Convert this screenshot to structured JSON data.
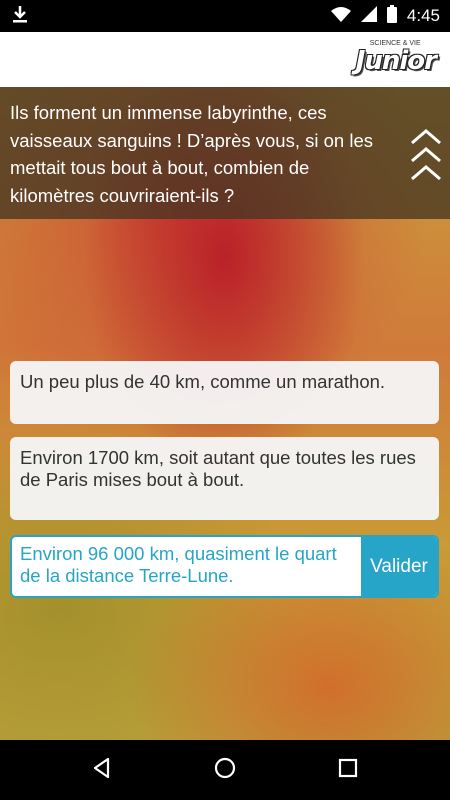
{
  "status_bar": {
    "time": "4:45",
    "icons": [
      "download-icon",
      "wifi-icon",
      "cellular-signal-icon",
      "battery-icon"
    ]
  },
  "header": {
    "logo_text": "Junior",
    "logo_small_text": "SCIENCE & VIE"
  },
  "question": {
    "text": "Ils forment un immense labyrinthe, ces vaisseaux sanguins ! D’après vous, si on les mettait tous bout à bout, combien de kilomètres couvriraient-ils ?"
  },
  "answers": [
    {
      "label": "Un peu plus de 40 km, comme un marathon."
    },
    {
      "label": "Environ 1700 km, soit autant que toutes les rues de Paris mises bout à bout."
    },
    {
      "label": "Environ 96 000 km, quasiment le quart de la distance Terre-Lune.",
      "selected": true
    }
  ],
  "validate_label": "Valider",
  "colors": {
    "accent": "#26a5c8",
    "panel": "#46372380"
  },
  "nav_bar": {
    "icons": [
      "back-icon",
      "home-icon",
      "recents-icon"
    ]
  }
}
